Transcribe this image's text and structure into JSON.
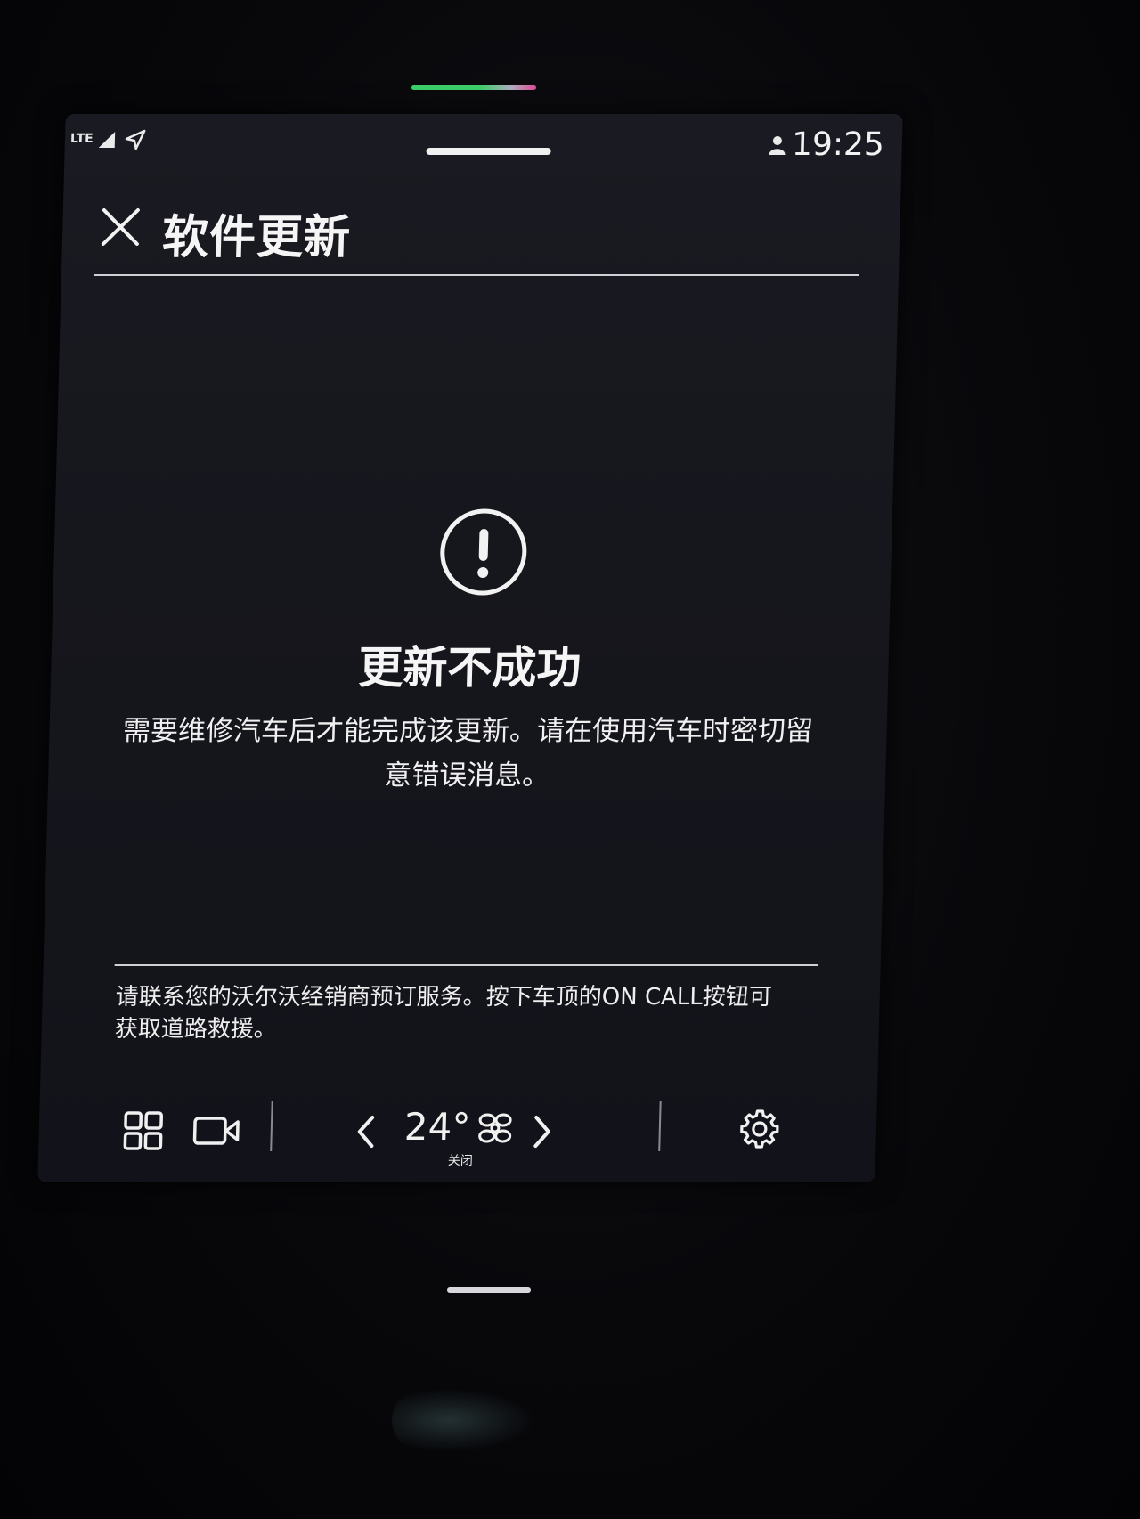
{
  "status_bar": {
    "network": "LTE",
    "time": "19:25"
  },
  "header": {
    "title": "软件更新"
  },
  "result": {
    "title": "更新不成功",
    "message_line1": "需要维修汽车后才能完成该更新。请在使用汽车时密切留",
    "message_line2": "意错误消息。"
  },
  "footer": {
    "note_line1": "请联系您的沃尔沃经销商预订服务。按下车顶的ON CALL按钮可",
    "note_line2": "获取道路救援。"
  },
  "climate": {
    "temperature": "24°",
    "fan_status": "关闭"
  },
  "colors": {
    "background": "#16161d",
    "text": "#f5f5f5",
    "divider": "#cfcfd4",
    "led_green": "#3cd06a",
    "led_pink": "#e04a9a"
  }
}
